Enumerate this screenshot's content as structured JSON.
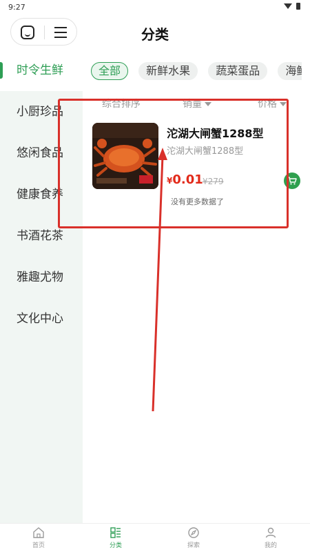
{
  "status_bar": {
    "time": "9:27"
  },
  "header": {
    "title": "分类"
  },
  "sidebar": {
    "items": [
      {
        "label": "时令生鲜",
        "active": true
      },
      {
        "label": "小厨珍品",
        "active": false
      },
      {
        "label": "悠闲食品",
        "active": false
      },
      {
        "label": "健康食养",
        "active": false
      },
      {
        "label": "书酒花茶",
        "active": false
      },
      {
        "label": "雅趣尤物",
        "active": false
      },
      {
        "label": "文化中心",
        "active": false
      }
    ]
  },
  "chips": [
    {
      "label": "全部",
      "active": true
    },
    {
      "label": "新鲜水果",
      "active": false
    },
    {
      "label": "蔬菜蛋品",
      "active": false
    },
    {
      "label": "海鲜",
      "active": false
    }
  ],
  "sort_bar": {
    "comprehensive": "综合排序",
    "sales": "销量",
    "price": "价格"
  },
  "product": {
    "name": "沱湖大闸蟹1288型",
    "subtitle": "沱湖大闸蟹1288型",
    "price_symbol": "¥",
    "price": "0.01",
    "original_price": "¥279"
  },
  "list_footer": "没有更多数据了",
  "tabbar": {
    "items": [
      {
        "label": "首页",
        "icon": "home-icon",
        "active": false
      },
      {
        "label": "分类",
        "icon": "category-icon",
        "active": true
      },
      {
        "label": "探索",
        "icon": "compass-icon",
        "active": false
      },
      {
        "label": "我的",
        "icon": "person-icon",
        "active": false
      }
    ]
  },
  "colors": {
    "accent": "#2e9e55",
    "price": "#e22a1a",
    "annotation": "#d9302a",
    "sidebar_bg": "#f1f6f3"
  }
}
